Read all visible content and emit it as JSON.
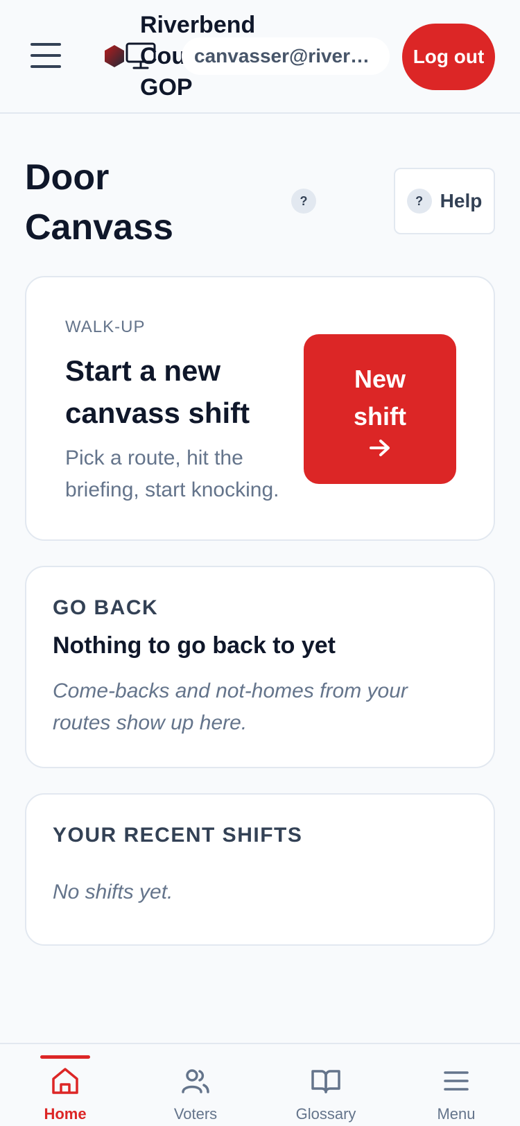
{
  "header": {
    "org_name": "Riverbend County GOP",
    "user_email": "canvasser@riverbend.gop",
    "logout_label": "Log out"
  },
  "page": {
    "title": "Door Canvass",
    "help_dot": "?",
    "help_icon": "?",
    "help_label": "Help"
  },
  "new_shift_card": {
    "eyebrow": "WALK-UP",
    "title": "Start a new canvass shift",
    "description": "Pick a route, hit the briefing, start knocking.",
    "button_label": "New shift"
  },
  "go_back_card": {
    "eyebrow": "GO BACK",
    "title": "Nothing to go back to yet",
    "description": "Come-backs and not-homes from your routes show up here."
  },
  "recent_shifts_card": {
    "eyebrow": "YOUR RECENT SHIFTS",
    "empty_text": "No shifts yet."
  },
  "bottom_nav": {
    "items": [
      {
        "label": "Home",
        "icon": "home-icon",
        "active": true
      },
      {
        "label": "Voters",
        "icon": "users-icon",
        "active": false
      },
      {
        "label": "Glossary",
        "icon": "book-icon",
        "active": false
      },
      {
        "label": "Menu",
        "icon": "menu-icon",
        "active": false
      }
    ]
  },
  "colors": {
    "accent": "#dc2626",
    "text": "#0f172a",
    "muted": "#64748b",
    "border": "#e2e8f0",
    "background": "#f8fafc"
  }
}
